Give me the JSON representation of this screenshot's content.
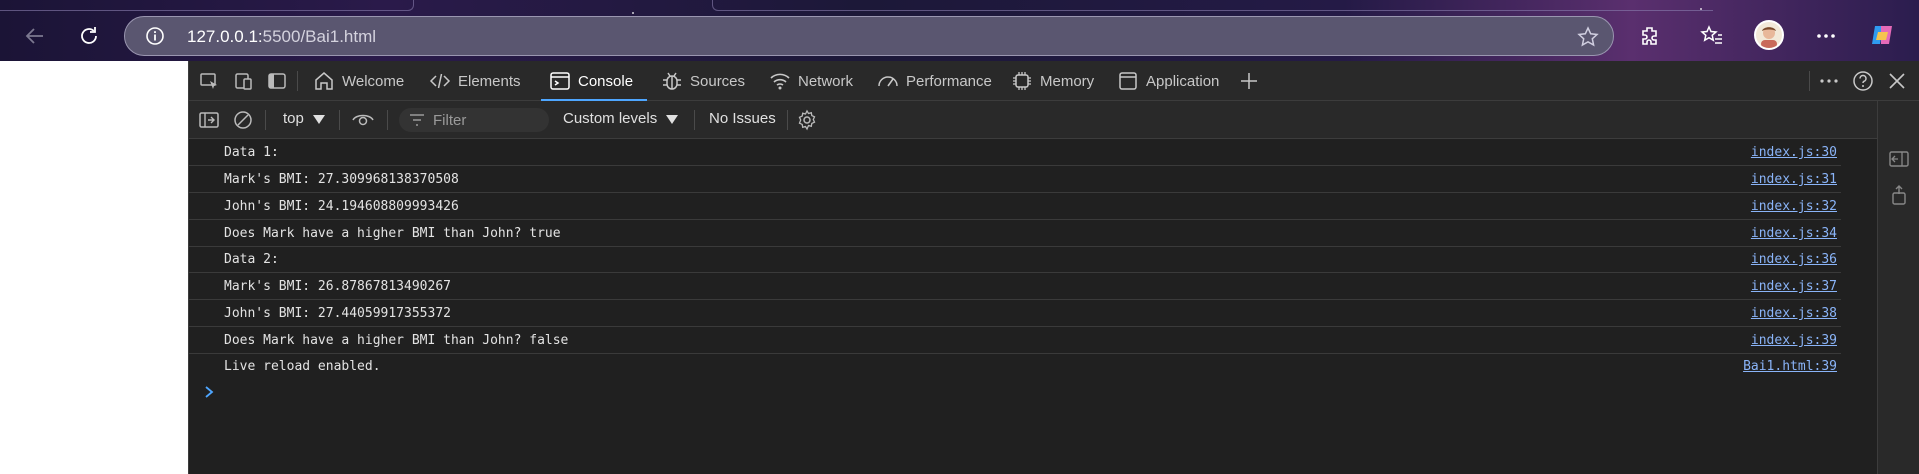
{
  "browser": {
    "url_host": "127.0.0.1:",
    "url_path": "5500/Bai1.html",
    "icons": [
      "back-icon",
      "refresh-icon",
      "site-info-icon",
      "favorite-star-icon",
      "extensions-icon",
      "favorites-icon",
      "profile-avatar",
      "more-icon",
      "copilot-icon"
    ]
  },
  "devtools": {
    "tabs": [
      {
        "label": "Welcome",
        "icon": "home-icon"
      },
      {
        "label": "Elements",
        "icon": "code-icon"
      },
      {
        "label": "Console",
        "icon": "console-icon",
        "active": true
      },
      {
        "label": "Sources",
        "icon": "bug-icon"
      },
      {
        "label": "Network",
        "icon": "wifi-icon"
      },
      {
        "label": "Performance",
        "icon": "gauge-icon"
      },
      {
        "label": "Memory",
        "icon": "chip-icon"
      },
      {
        "label": "Application",
        "icon": "window-icon"
      }
    ],
    "toolbar": {
      "context": "top",
      "filter_placeholder": "Filter",
      "levels": "Custom levels",
      "issues": "No Issues"
    },
    "messages": [
      {
        "text": "Data 1:",
        "source": "index.js:30"
      },
      {
        "text": "Mark's BMI: 27.309968138370508",
        "source": "index.js:31"
      },
      {
        "text": "John's BMI: 24.194608809993426",
        "source": "index.js:32"
      },
      {
        "text": "Does Mark have a higher BMI than John? true",
        "source": "index.js:34"
      },
      {
        "text": "Data 2:",
        "source": "index.js:36"
      },
      {
        "text": "Mark's BMI: 26.87867813490267",
        "source": "index.js:37"
      },
      {
        "text": "John's BMI: 27.44059917355372",
        "source": "index.js:38"
      },
      {
        "text": "Does Mark have a higher BMI than John? false",
        "source": "index.js:39"
      },
      {
        "text": "Live reload enabled.",
        "source": "Bai1.html:39"
      }
    ],
    "colors": {
      "accent": "#4ea6ff",
      "link": "#8ab4f8",
      "panel": "#202020"
    }
  }
}
